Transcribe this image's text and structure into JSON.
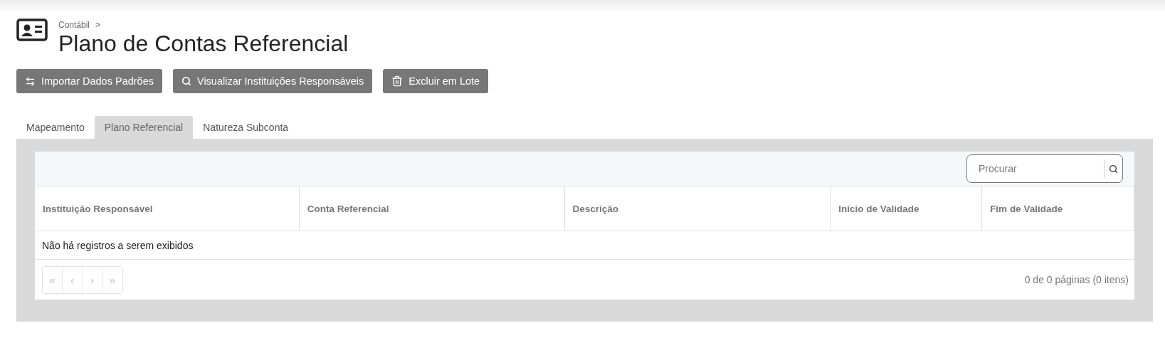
{
  "breadcrumb": {
    "label": "Contábil",
    "separator": ">"
  },
  "title": "Plano de Contas Referencial",
  "actions": [
    {
      "kind": "import",
      "label": "Importar Dados Padrões"
    },
    {
      "kind": "search",
      "label": "Visualizar Instituições Responsáveis"
    },
    {
      "kind": "delete",
      "label": "Excluir em Lote"
    }
  ],
  "tabs": [
    {
      "label": "Mapeamento",
      "selected": false
    },
    {
      "label": "Plano Referencial",
      "selected": true
    },
    {
      "label": "Natureza Subconta",
      "selected": false
    }
  ],
  "search": {
    "placeholder": "Procurar"
  },
  "table": {
    "columns": [
      "Instituição Responsável",
      "Conta Referencial",
      "Descrição",
      "Início de Validade",
      "Fim de Validade"
    ],
    "empty_message": "Não há registros a serem exibidos"
  },
  "pager": {
    "buttons": [
      {
        "label": "«",
        "disabled": true
      },
      {
        "label": "‹",
        "disabled": true
      },
      {
        "label": "›",
        "disabled": true
      },
      {
        "label": "»",
        "disabled": true
      }
    ],
    "summary": "0 de 0 páginas (0 itens)"
  }
}
